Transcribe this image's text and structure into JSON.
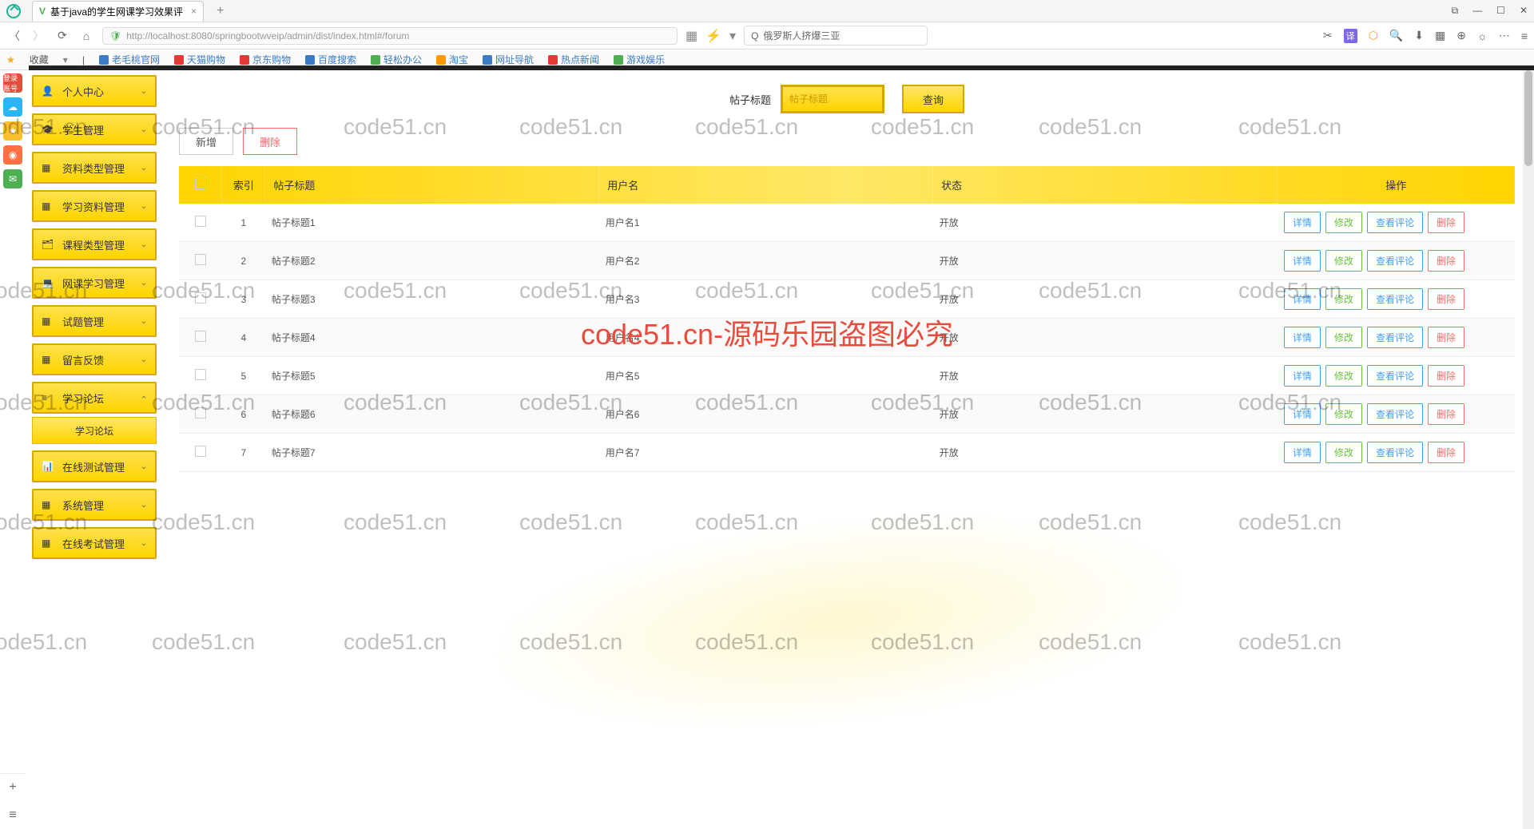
{
  "browser": {
    "tab_title": "基于java的学生网课学习效果评",
    "url_display": "http://localhost:8080/springbootwveip/admin/dist/index.html#/forum",
    "search_value": "俄罗斯人挤爆三亚",
    "bookmarks_label": "收藏",
    "bookmarks": [
      "老毛桃官网",
      "天猫购物",
      "京东购物",
      "百度搜索",
      "轻松办公",
      "淘宝",
      "网址导航",
      "热点新闻",
      "游戏娱乐"
    ]
  },
  "sidebar": {
    "items": [
      {
        "icon": "👤",
        "label": "个人中心",
        "open": false
      },
      {
        "icon": "🎓",
        "label": "学生管理",
        "open": false
      },
      {
        "icon": "▦",
        "label": "资料类型管理",
        "open": false
      },
      {
        "icon": "▦",
        "label": "学习资料管理",
        "open": false
      },
      {
        "icon": "🗂",
        "label": "课程类型管理",
        "open": false
      },
      {
        "icon": "💻",
        "label": "网课学习管理",
        "open": false
      },
      {
        "icon": "▦",
        "label": "试题管理",
        "open": false
      },
      {
        "icon": "▦",
        "label": "留言反馈",
        "open": false
      },
      {
        "icon": "≡",
        "label": "学习论坛",
        "open": true,
        "sub": "学习论坛"
      },
      {
        "icon": "📊",
        "label": "在线测试管理",
        "open": false
      },
      {
        "icon": "▦",
        "label": "系统管理",
        "open": false
      },
      {
        "icon": "▦",
        "label": "在线考试管理",
        "open": false
      }
    ]
  },
  "search": {
    "label": "帖子标题",
    "placeholder": "帖子标题",
    "query_btn": "查询"
  },
  "actions": {
    "add": "新增",
    "delete": "删除"
  },
  "table": {
    "headers": {
      "index": "索引",
      "title": "帖子标题",
      "user": "用户名",
      "status": "状态",
      "op": "操作"
    },
    "op_labels": {
      "detail": "详情",
      "edit": "修改",
      "view": "查看评论",
      "delete": "删除"
    },
    "rows": [
      {
        "idx": "1",
        "title": "帖子标题1",
        "user": "用户名1",
        "status": "开放"
      },
      {
        "idx": "2",
        "title": "帖子标题2",
        "user": "用户名2",
        "status": "开放"
      },
      {
        "idx": "3",
        "title": "帖子标题3",
        "user": "用户名3",
        "status": "开放"
      },
      {
        "idx": "4",
        "title": "帖子标题4",
        "user": "用户名4",
        "status": "开放"
      },
      {
        "idx": "5",
        "title": "帖子标题5",
        "user": "用户名5",
        "status": "开放"
      },
      {
        "idx": "6",
        "title": "帖子标题6",
        "user": "用户名6",
        "status": "开放"
      },
      {
        "idx": "7",
        "title": "帖子标题7",
        "user": "用户名7",
        "status": "开放"
      }
    ]
  },
  "watermark": {
    "text": "code51.cn",
    "main": "code51.cn-源码乐园盗图必究"
  },
  "dock": {
    "login": "登录账号"
  }
}
